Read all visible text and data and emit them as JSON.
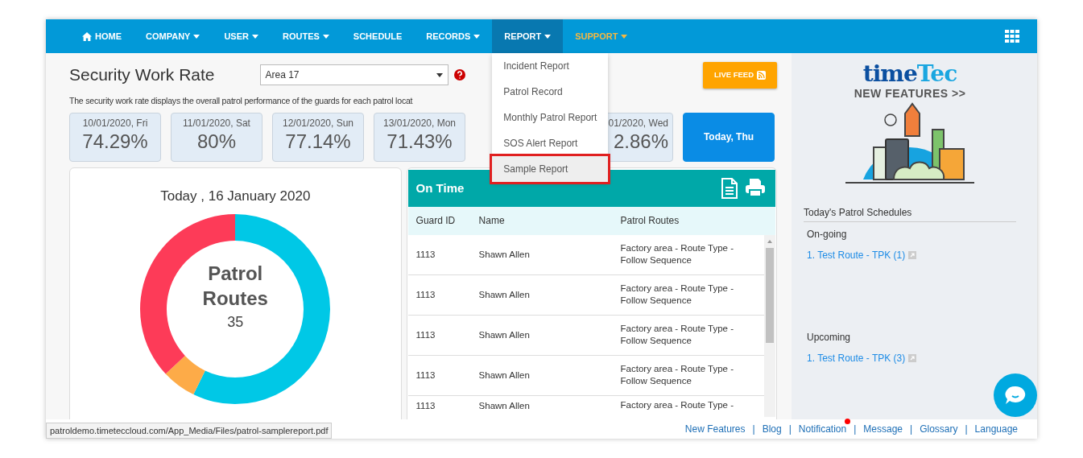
{
  "nav": {
    "items": [
      {
        "label": "HOME",
        "kind": "home",
        "dropdown": false,
        "selected": false
      },
      {
        "label": "COMPANY",
        "dropdown": true,
        "selected": false
      },
      {
        "label": "USER",
        "dropdown": true,
        "selected": false
      },
      {
        "label": "ROUTES",
        "dropdown": true,
        "selected": false
      },
      {
        "label": "SCHEDULE",
        "dropdown": false,
        "selected": false
      },
      {
        "label": "RECORDS",
        "dropdown": true,
        "selected": false
      },
      {
        "label": "REPORT",
        "dropdown": true,
        "selected": true,
        "menu": [
          {
            "label": "Incident Report",
            "selected": false
          },
          {
            "label": "Patrol Record",
            "selected": false
          },
          {
            "label": "Monthly Patrol Report",
            "selected": false
          },
          {
            "label": "SOS Alert Report",
            "selected": false
          },
          {
            "label": "Sample Report",
            "selected": true
          }
        ]
      },
      {
        "label": "SUPPORT",
        "dropdown": true,
        "selected": false,
        "color": "#f5b841"
      }
    ]
  },
  "header": {
    "title": "Security Work Rate",
    "area_select": {
      "value": "Area 17"
    },
    "live_feed": "LIVE FEED",
    "description": "The security work rate displays the overall patrol performance of the guards for each patrol locat"
  },
  "day_cards": [
    {
      "kind": "day",
      "date": "10/01/2020, Fri",
      "rate": "74.29%",
      "selected": false
    },
    {
      "kind": "day",
      "date": "11/01/2020, Sat",
      "rate": "80%",
      "selected": false
    },
    {
      "kind": "day",
      "date": "12/01/2020, Sun",
      "rate": "77.14%",
      "selected": false
    },
    {
      "kind": "day",
      "date": "13/01/2020, Mon",
      "rate": "71.43%",
      "selected": false
    },
    {
      "kind": "partial",
      "date": "01/2020, Wed",
      "rate": "2.86%",
      "selected": false
    },
    {
      "kind": "today",
      "label": "Today, Thu",
      "selected": true
    }
  ],
  "summary": {
    "title": "Today , 16 January 2020",
    "center_title": "Patrol Routes",
    "center_value": "35"
  },
  "on_time": {
    "title": "On Time",
    "columns": [
      "Guard ID",
      "Name",
      "Patrol Routes"
    ],
    "rows": [
      [
        "1113",
        "Shawn Allen",
        "Factory area - Route Type - Follow Sequence"
      ],
      [
        "1113",
        "Shawn Allen",
        "Factory area - Route Type - Follow Sequence"
      ],
      [
        "1113",
        "Shawn Allen",
        "Factory area - Route Type - Follow Sequence"
      ],
      [
        "1113",
        "Shawn Allen",
        "Factory area - Route Type - Follow Sequence"
      ],
      [
        "1113",
        "Shawn Allen",
        "Factory area - Route Type -"
      ]
    ]
  },
  "sidebar": {
    "brand": [
      "time",
      "Tec"
    ],
    "banner": "NEW FEATURES >>",
    "schedules_title": "Today's Patrol Schedules",
    "sections": [
      {
        "title": "On-going",
        "links": [
          "1. Test Route - TPK (1)"
        ]
      },
      {
        "title": "Upcoming",
        "links": [
          "1. Test Route - TPK (3)"
        ]
      }
    ]
  },
  "footer": {
    "items": [
      {
        "kind": "link",
        "label": "New Features"
      },
      {
        "kind": "sep",
        "label": "|"
      },
      {
        "kind": "link",
        "label": "Blog"
      },
      {
        "kind": "sep",
        "label": "|"
      },
      {
        "kind": "link",
        "label": "Notification",
        "badge": true
      },
      {
        "kind": "sep",
        "label": "|"
      },
      {
        "kind": "link",
        "label": "Message"
      },
      {
        "kind": "sep",
        "label": "|"
      },
      {
        "kind": "link",
        "label": "Glossary"
      },
      {
        "kind": "sep",
        "label": "|"
      },
      {
        "kind": "link",
        "label": "Language"
      }
    ]
  },
  "status_url": "patroldemo.timeteccloud.com/App_Media/Files/patrol-samplereport.pdf"
}
